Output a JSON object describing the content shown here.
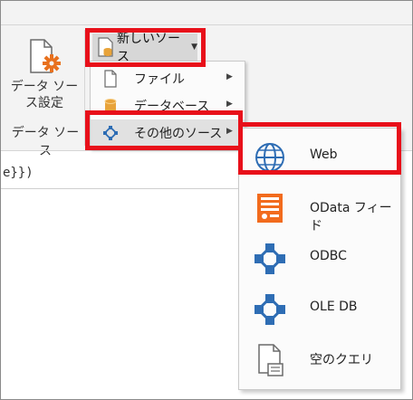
{
  "ribbon": {
    "data_source_settings_label_line1": "データ ソー",
    "data_source_settings_label_line2": "ス設定",
    "group_label": "データ ソース",
    "new_source_label": "新しいソース"
  },
  "formula": {
    "text": "e}})"
  },
  "menu": {
    "items": [
      {
        "label": "ファイル",
        "icon": "file-icon"
      },
      {
        "label": "データベース",
        "icon": "database-icon"
      },
      {
        "label": "その他のソース",
        "icon": "other-sources-icon"
      }
    ]
  },
  "submenu": {
    "items": [
      {
        "label": "Web",
        "icon": "globe-icon"
      },
      {
        "label": "OData フィード",
        "icon": "odata-feed-icon"
      },
      {
        "label": "ODBC",
        "icon": "connector-icon"
      },
      {
        "label": "OLE DB",
        "icon": "connector-icon"
      },
      {
        "label": "空のクエリ",
        "icon": "blank-query-icon"
      }
    ]
  },
  "colors": {
    "highlight": "#e8101a",
    "ribbon_bg": "#f3f3f3",
    "connector_blue": "#2e6db4",
    "odata_orange": "#f26b1d",
    "gear_orange": "#e8711e"
  }
}
